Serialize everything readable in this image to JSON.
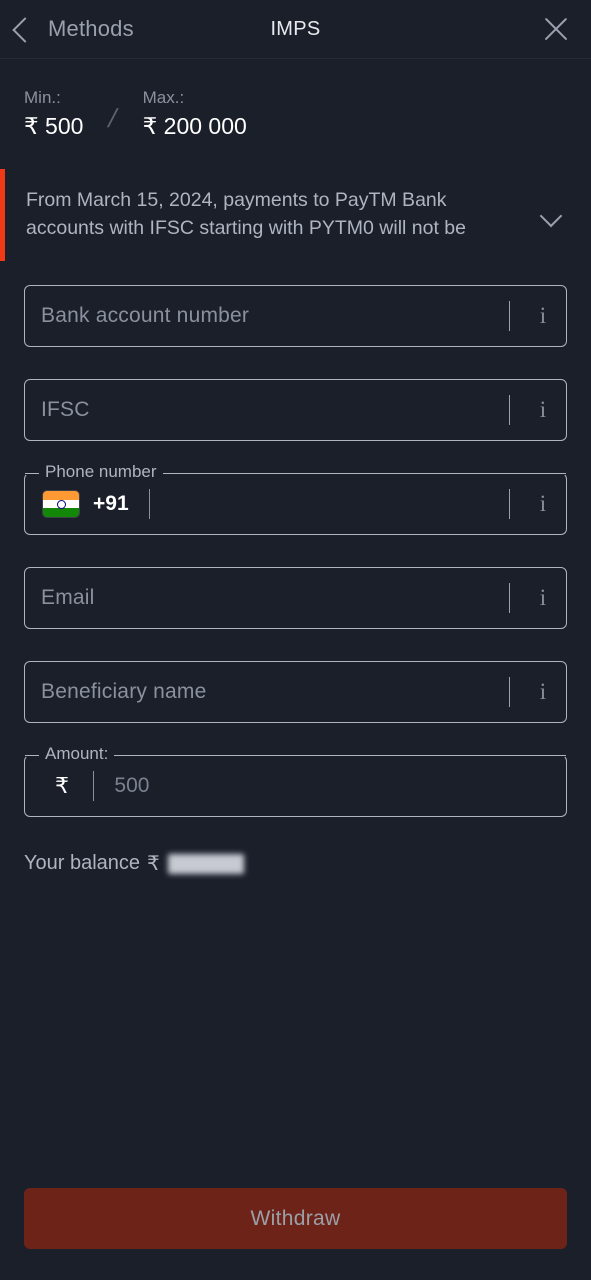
{
  "header": {
    "back_label": "Methods",
    "title": "IMPS",
    "back_icon": "chevron-left-icon",
    "close_icon": "close-icon"
  },
  "limits": {
    "min_label": "Min.:",
    "min_value": "₹ 500",
    "separator": "/",
    "max_label": "Max.:",
    "max_value": "₹ 200 000"
  },
  "notice": {
    "text": "From March 15, 2024, payments to PayTM Bank accounts with IFSC starting with PYTM0 will not be",
    "accent_color": "#f03a17",
    "expand_icon": "chevron-down-icon"
  },
  "form": {
    "bank_account": {
      "placeholder": "Bank account number",
      "value": "",
      "info_icon": "info-icon"
    },
    "ifsc": {
      "placeholder": "IFSC",
      "value": "",
      "info_icon": "info-icon"
    },
    "phone": {
      "legend": "Phone number",
      "flag_icon": "india-flag-icon",
      "dial_code": "+91",
      "value": "",
      "info_icon": "info-icon"
    },
    "email": {
      "placeholder": "Email",
      "value": "",
      "info_icon": "info-icon"
    },
    "beneficiary": {
      "placeholder": "Beneficiary name",
      "value": "",
      "info_icon": "info-icon"
    },
    "amount": {
      "legend": "Amount:",
      "currency": "₹",
      "placeholder": "500",
      "value": ""
    }
  },
  "balance": {
    "label": "Your balance",
    "currency": "₹",
    "value": ""
  },
  "footer": {
    "withdraw_label": "Withdraw",
    "withdraw_bg": "#6e2319",
    "withdraw_text_color": "#9aa0a8"
  }
}
